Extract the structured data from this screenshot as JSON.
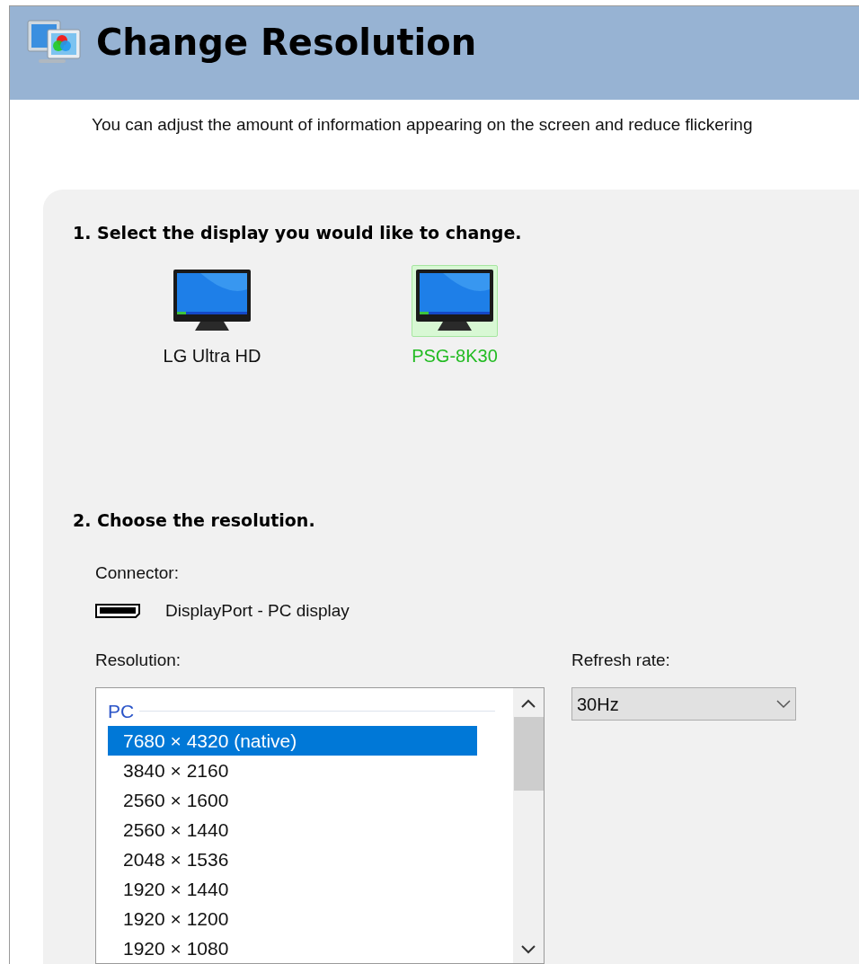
{
  "header": {
    "title": "Change Resolution"
  },
  "description": "You can adjust the amount of information appearing on the screen and reduce flickering",
  "step1": {
    "title": "1. Select the display you would like to change.",
    "displays": [
      {
        "name": "LG Ultra HD",
        "selected": false
      },
      {
        "name": "PSG-8K30",
        "selected": true
      }
    ]
  },
  "step2": {
    "title": "2. Choose the resolution.",
    "connector": {
      "label": "Connector:",
      "value": "DisplayPort - PC display"
    },
    "resolution": {
      "label": "Resolution:",
      "group": "PC",
      "items": [
        {
          "text": "7680 × 4320 (native)",
          "selected": true
        },
        {
          "text": "3840 × 2160",
          "selected": false
        },
        {
          "text": "2560 × 1600",
          "selected": false
        },
        {
          "text": "2560 × 1440",
          "selected": false
        },
        {
          "text": "2048 × 1536",
          "selected": false
        },
        {
          "text": "1920 × 1440",
          "selected": false
        },
        {
          "text": "1920 × 1200",
          "selected": false
        },
        {
          "text": "1920 × 1080",
          "selected": false
        }
      ]
    },
    "refresh": {
      "label": "Refresh rate:",
      "value": "30Hz"
    }
  }
}
